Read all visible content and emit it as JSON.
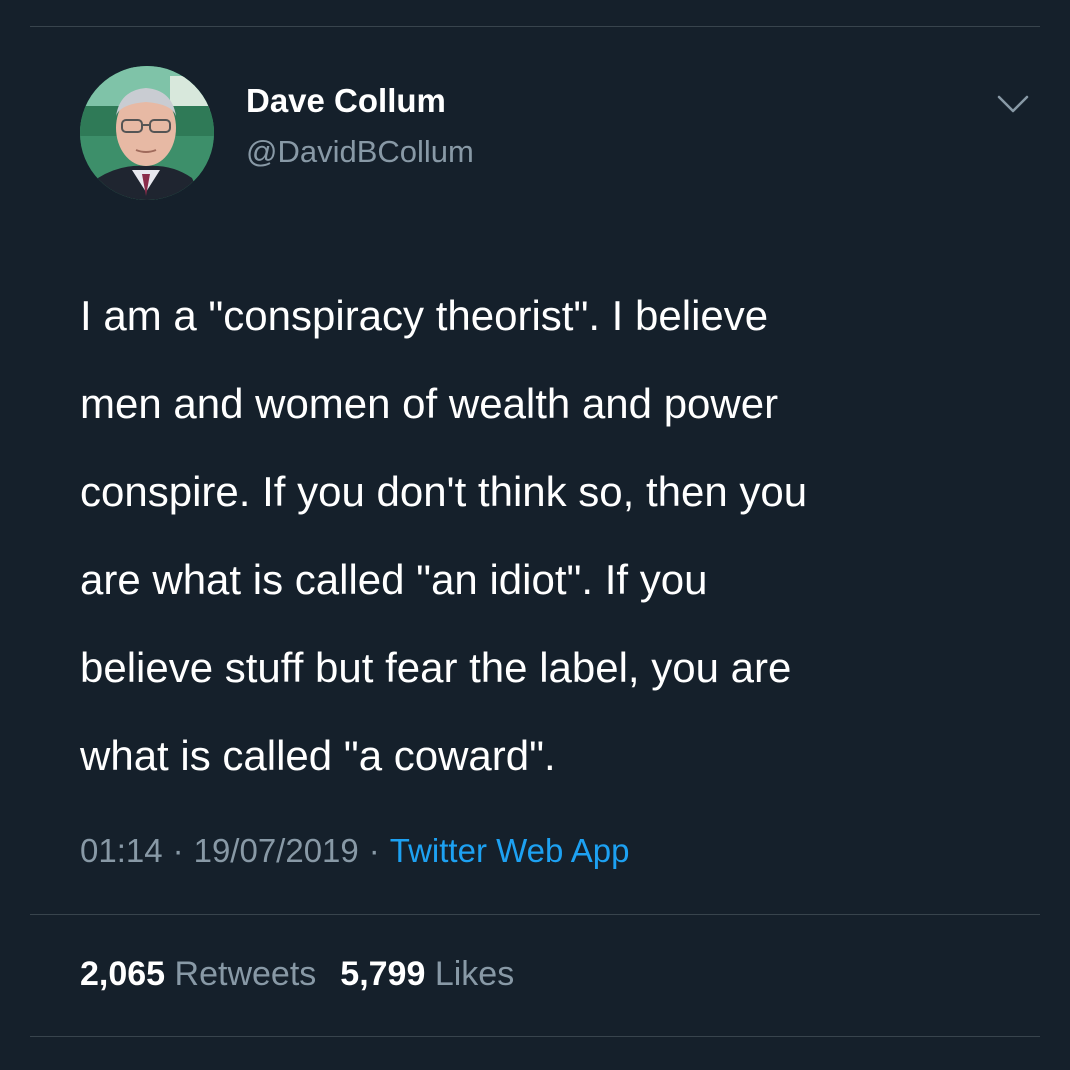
{
  "user": {
    "display_name": "Dave Collum",
    "handle": "@DavidBCollum"
  },
  "icons": {
    "menu": "chevron-down-icon",
    "avatar": "profile-photo"
  },
  "tweet": {
    "lines": [
      "I am a \"conspiracy theorist\". I believe",
      "men and women of wealth and power",
      "conspire. If you don't think so, then you",
      "are what is called \"an idiot\". If you",
      "believe stuff but fear the label, you are",
      "what is called \"a coward\"."
    ]
  },
  "meta": {
    "time": "01:14",
    "separator": "·",
    "date": "19/07/2019",
    "source": "Twitter Web App"
  },
  "stats": {
    "retweets_count": "2,065",
    "retweets_label": "Retweets",
    "likes_count": "5,799",
    "likes_label": "Likes"
  },
  "colors": {
    "background": "#15202b",
    "primary_text": "#ffffff",
    "secondary_text": "#8899a6",
    "accent": "#1da1f2",
    "divider": "#38444d"
  }
}
